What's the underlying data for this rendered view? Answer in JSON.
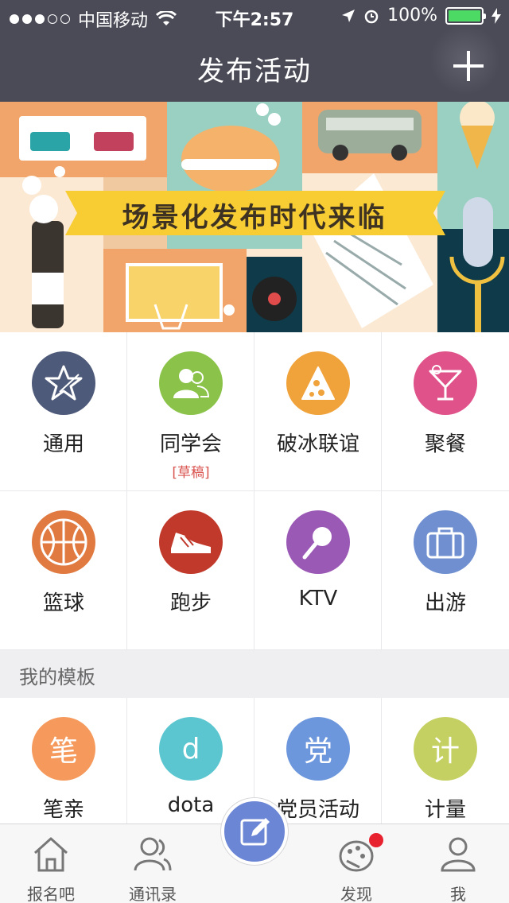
{
  "status_bar": {
    "carrier": "中国移动",
    "time": "下午2:57",
    "battery": "100%"
  },
  "nav": {
    "title": "发布活动"
  },
  "banner": {
    "text": "场景化发布时代来临"
  },
  "categories": [
    {
      "label": "通用",
      "icon": "star-icon",
      "color": "#4e5a7a"
    },
    {
      "label": "同学会",
      "sub": "[草稿]",
      "icon": "people-icon",
      "color": "#8bc34a"
    },
    {
      "label": "破冰联谊",
      "icon": "pizza-icon",
      "color": "#f0a23b"
    },
    {
      "label": "聚餐",
      "icon": "cocktail-icon",
      "color": "#e0528a"
    },
    {
      "label": "篮球",
      "icon": "basketball-icon",
      "color": "#e07a40"
    },
    {
      "label": "跑步",
      "icon": "sneaker-icon",
      "color": "#c0392b"
    },
    {
      "label": "KTV",
      "icon": "microphone-icon",
      "color": "#9b59b6"
    },
    {
      "label": "出游",
      "icon": "suitcase-icon",
      "color": "#6f8fd0"
    }
  ],
  "templates_section": {
    "title": "我的模板"
  },
  "templates": [
    {
      "label": "笔亲",
      "glyph": "笔",
      "color": "#f59a5c"
    },
    {
      "label": "dota",
      "glyph": "d",
      "color": "#5bc6cf"
    },
    {
      "label": "党员活动",
      "glyph": "党",
      "color": "#6d97dd"
    },
    {
      "label": "计量",
      "glyph": "计",
      "color": "#c5d062"
    }
  ],
  "tabbar": {
    "items": [
      {
        "label": "报名吧",
        "icon": "home-icon"
      },
      {
        "label": "通讯录",
        "icon": "contacts-icon"
      },
      {
        "label": "",
        "icon": "compose-icon"
      },
      {
        "label": "发现",
        "icon": "discover-icon"
      },
      {
        "label": "我",
        "icon": "profile-icon"
      }
    ]
  }
}
